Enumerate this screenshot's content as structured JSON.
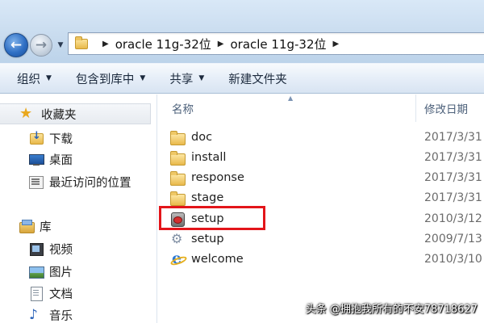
{
  "address_bar": {
    "crumbs": [
      "oracle 11g-32位",
      "oracle 11g-32位"
    ]
  },
  "toolbar": {
    "organize": "组织",
    "include_in_library": "包含到库中",
    "share": "共享",
    "new_folder": "新建文件夹"
  },
  "nav": {
    "favorites": "收藏夹",
    "favorites_items": [
      "下载",
      "桌面",
      "最近访问的位置"
    ],
    "libraries": "库",
    "library_items": [
      "视频",
      "图片",
      "文档",
      "音乐"
    ]
  },
  "list": {
    "columns": {
      "name": "名称",
      "date": "修改日期"
    },
    "files": [
      {
        "name": "doc",
        "date": "2017/3/31",
        "icon": "folder-icon"
      },
      {
        "name": "install",
        "date": "2017/3/31",
        "icon": "folder-icon"
      },
      {
        "name": "response",
        "date": "2017/3/31",
        "icon": "folder-icon"
      },
      {
        "name": "stage",
        "date": "2017/3/31",
        "icon": "folder-icon"
      },
      {
        "name": "setup",
        "date": "2010/3/12",
        "icon": "setup-exe-icon"
      },
      {
        "name": "setup",
        "date": "2009/7/13",
        "icon": "config-file-icon"
      },
      {
        "name": "welcome",
        "date": "2010/3/10",
        "icon": "ie-html-icon"
      }
    ]
  },
  "annotation": {
    "color": "#e3151a"
  },
  "watermark": "头条 @拥抱我所有的不安78718627"
}
